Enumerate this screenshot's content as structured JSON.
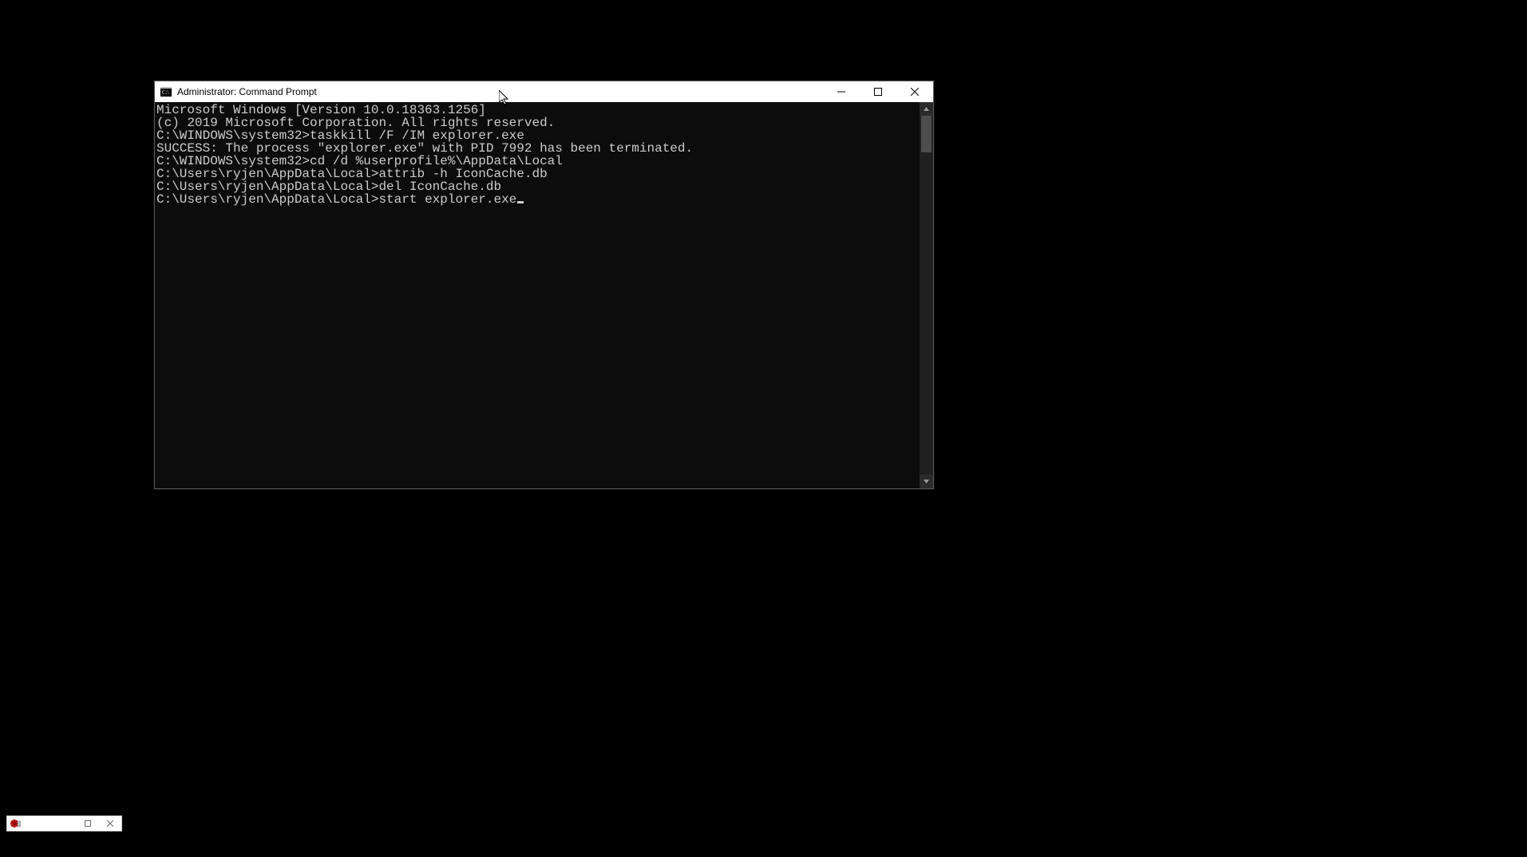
{
  "window": {
    "title": "Administrator: Command Prompt"
  },
  "console": {
    "lines": [
      "Microsoft Windows [Version 10.0.18363.1256]",
      "(c) 2019 Microsoft Corporation. All rights reserved.",
      "",
      "C:\\WINDOWS\\system32>taskkill /F /IM explorer.exe",
      "SUCCESS: The process \"explorer.exe\" with PID 7992 has been terminated.",
      "",
      "C:\\WINDOWS\\system32>cd /d %userprofile%\\AppData\\Local",
      "",
      "C:\\Users\\ryjen\\AppData\\Local>attrib -h IconCache.db",
      "",
      "C:\\Users\\ryjen\\AppData\\Local>del IconCache.db",
      ""
    ],
    "current_prompt": "C:\\Users\\ryjen\\AppData\\Local>",
    "current_input": "start explorer.exe"
  }
}
